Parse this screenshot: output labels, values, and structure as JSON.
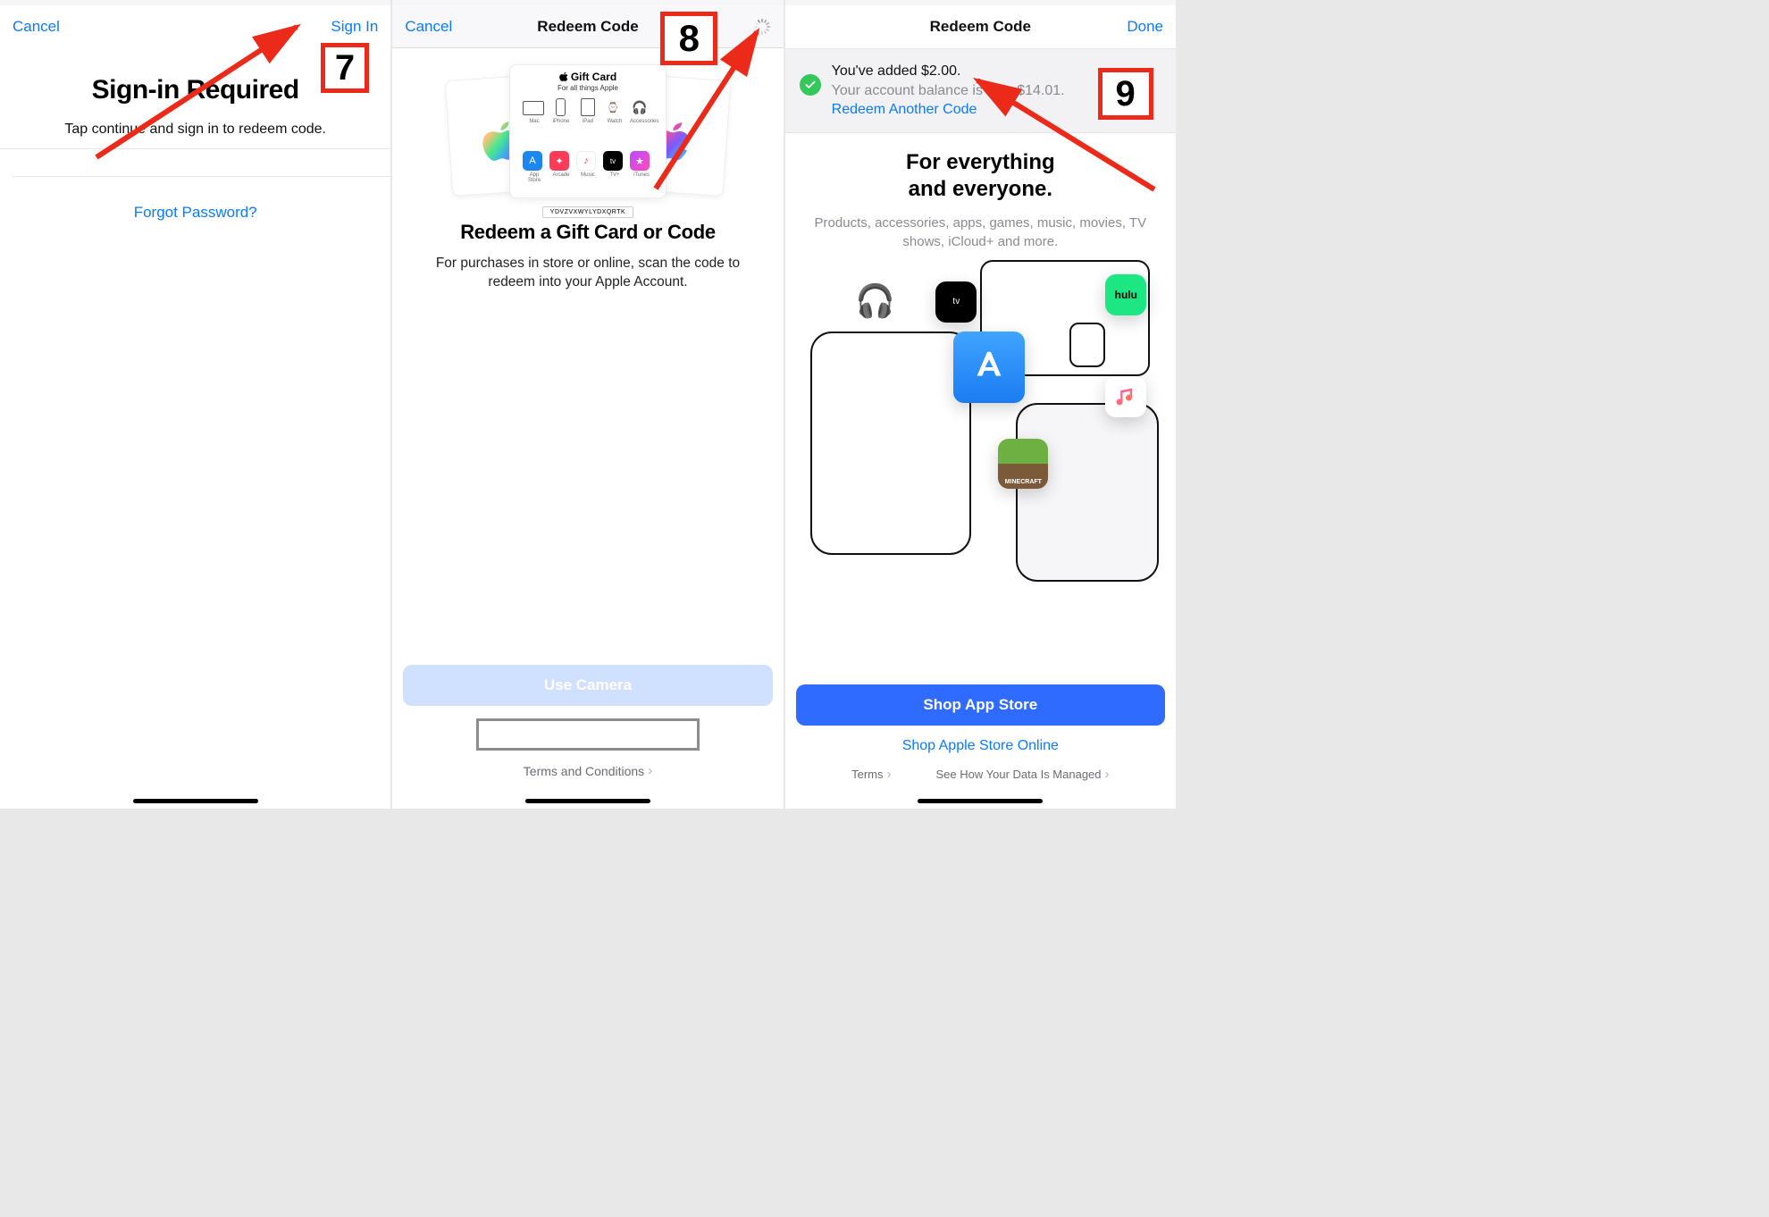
{
  "annotations": {
    "step7": "7",
    "step8": "8",
    "step9": "9"
  },
  "pane1": {
    "cancel": "Cancel",
    "signin": "Sign In",
    "title": "Sign-in Required",
    "subtitle": "Tap continue and sign in to redeem code.",
    "forgot": "Forgot Password?"
  },
  "pane2": {
    "cancel": "Cancel",
    "title": "Redeem Code",
    "giftcard": {
      "brand": "Gift Card",
      "tagline": "For all things Apple",
      "icons": [
        "Mac",
        "iPhone",
        "iPad",
        "Watch",
        "Accessories"
      ],
      "apps": [
        "App Store",
        "Arcade",
        "Music",
        "TV+",
        "iTunes"
      ],
      "sample_code": "YDVZVXWYLYDXQRTK"
    },
    "heading": "Redeem a Gift Card or Code",
    "description": "For purchases in store or online, scan the code to redeem into your Apple Account.",
    "use_camera": "Use Camera",
    "code_input_value": "",
    "terms": "Terms and Conditions"
  },
  "pane3": {
    "title": "Redeem Code",
    "done": "Done",
    "banner": {
      "line1": "You've added $2.00.",
      "line2": "Your account balance is now $14.01.",
      "link": "Redeem Another Code"
    },
    "heading_line1": "For everything",
    "heading_line2": "and everyone.",
    "sub": "Products, accessories, apps, games, music, movies, TV shows, iCloud+ and more.",
    "apps": {
      "atv": "tv",
      "hulu": "hulu",
      "appstore": "App Store",
      "music": "Music",
      "minecraft": "MINECRAFT"
    },
    "primary": "Shop App Store",
    "secondary_link": "Shop Apple Store Online",
    "footer_terms": "Terms",
    "footer_data": "See How Your Data Is Managed"
  }
}
